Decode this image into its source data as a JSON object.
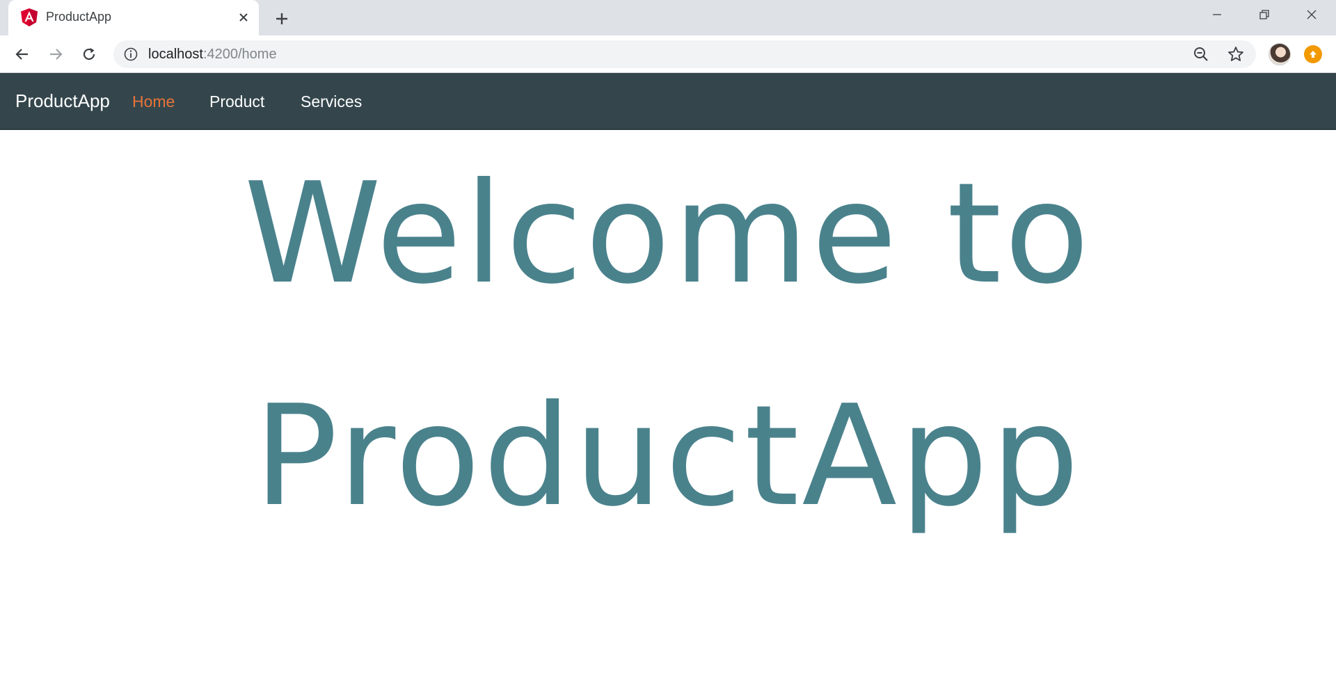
{
  "browser": {
    "tab": {
      "title": "ProductApp",
      "favicon": "angular-logo"
    },
    "address": {
      "host": "localhost",
      "path": ":4200/home"
    }
  },
  "app": {
    "brand": "ProductApp",
    "nav": [
      {
        "label": "Home",
        "active": true
      },
      {
        "label": "Product",
        "active": false
      },
      {
        "label": "Services",
        "active": false
      }
    ],
    "welcome": {
      "line1": "Welcome to",
      "line2": "ProductApp"
    }
  },
  "colors": {
    "navbar_bg": "#34464c",
    "nav_active": "#e8733a",
    "nav_text": "#ffffff",
    "heading": "#4a828c",
    "tabstrip": "#dee1e6",
    "update_badge": "#f29900"
  }
}
